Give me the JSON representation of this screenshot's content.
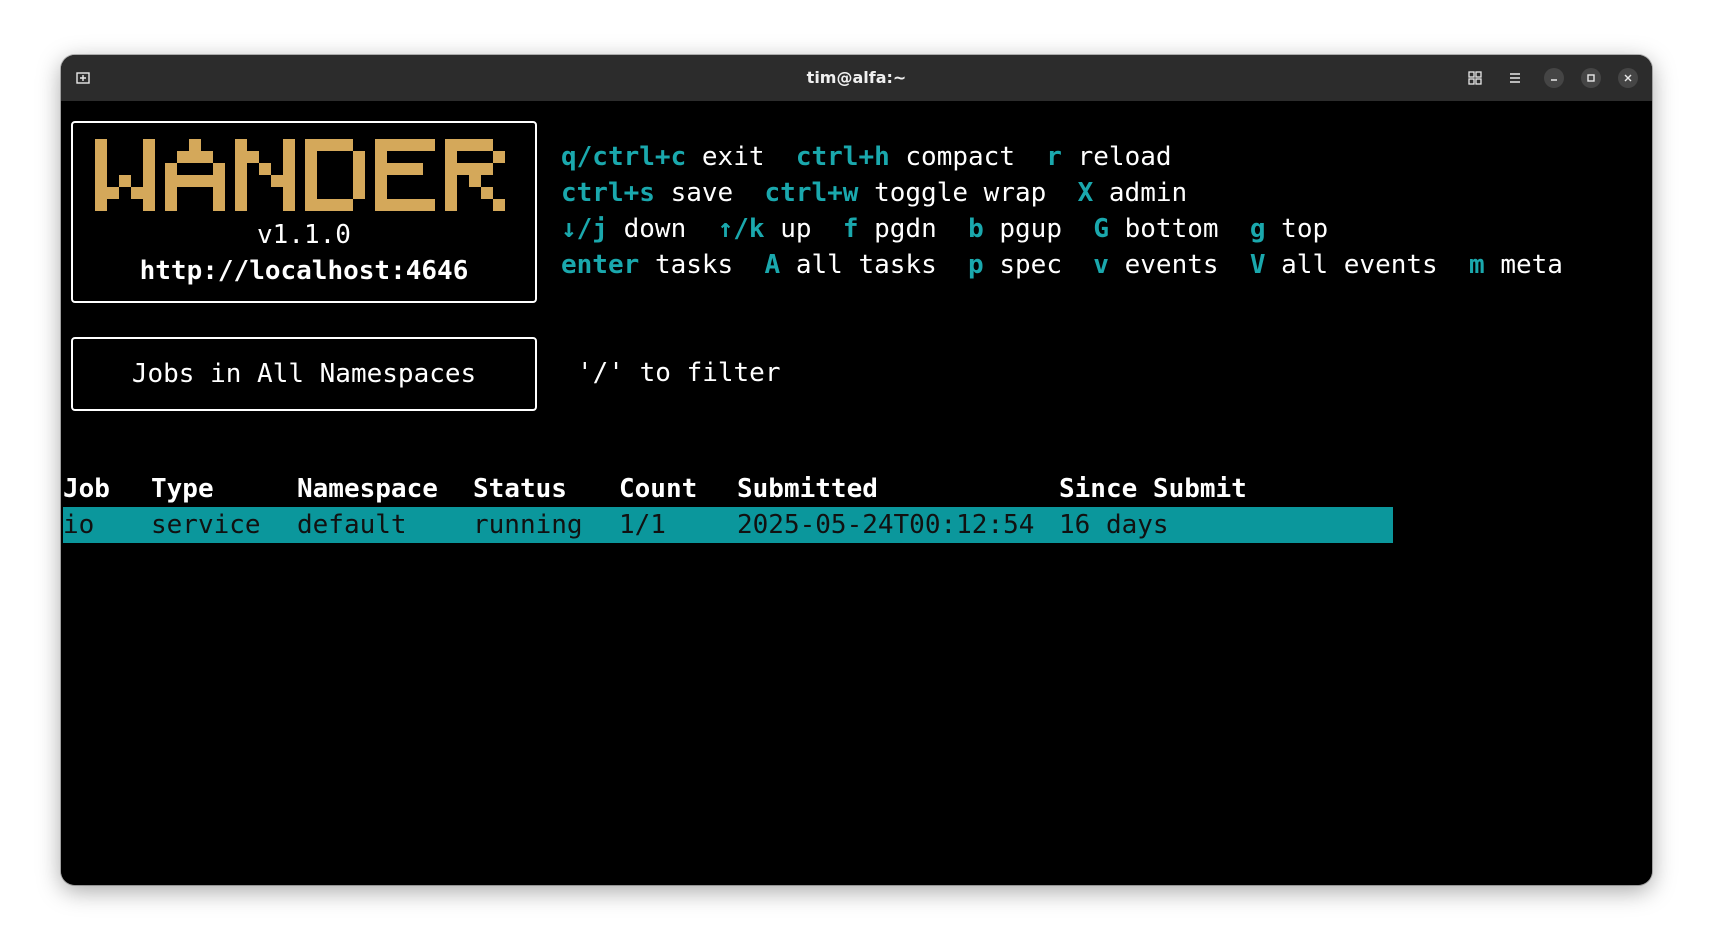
{
  "window": {
    "title": "tim@alfa:~"
  },
  "logo": {
    "text": "WANDER",
    "color": "#d4a85a",
    "version": "v1.1.0",
    "url": "http://localhost:4646"
  },
  "help": [
    [
      {
        "key": "q/ctrl+c",
        "desc": "exit"
      },
      {
        "key": "ctrl+h",
        "desc": "compact"
      },
      {
        "key": "r",
        "desc": "reload"
      }
    ],
    [
      {
        "key": "ctrl+s",
        "desc": "save"
      },
      {
        "key": "ctrl+w",
        "desc": "toggle wrap"
      },
      {
        "key": "X",
        "desc": "admin"
      }
    ],
    [
      {
        "key": "↓/j",
        "desc": "down"
      },
      {
        "key": "↑/k",
        "desc": "up"
      },
      {
        "key": "f",
        "desc": "pgdn"
      },
      {
        "key": "b",
        "desc": "pgup"
      },
      {
        "key": "G",
        "desc": "bottom"
      },
      {
        "key": "g",
        "desc": "top"
      }
    ],
    [
      {
        "key": "enter",
        "desc": "tasks"
      },
      {
        "key": "A",
        "desc": "all tasks"
      },
      {
        "key": "p",
        "desc": "spec"
      },
      {
        "key": "v",
        "desc": "events"
      },
      {
        "key": "V",
        "desc": "all events"
      },
      {
        "key": "m",
        "desc": "meta"
      }
    ]
  ],
  "jobs_panel": {
    "title": "Jobs in All Namespaces",
    "filter_hint": "'/' to filter"
  },
  "table": {
    "columns": [
      "Job",
      "Type",
      "Namespace",
      "Status",
      "Count",
      "Submitted",
      "Since Submit"
    ],
    "rows": [
      [
        "io",
        "service",
        "default",
        "running",
        "1/1",
        "2025-05-24T00:12:54",
        "16 days"
      ]
    ],
    "selected_row": 0
  },
  "colors": {
    "key": "#1aa8ad",
    "selection": "#0b979c",
    "titlebar": "#2c2c2c"
  }
}
